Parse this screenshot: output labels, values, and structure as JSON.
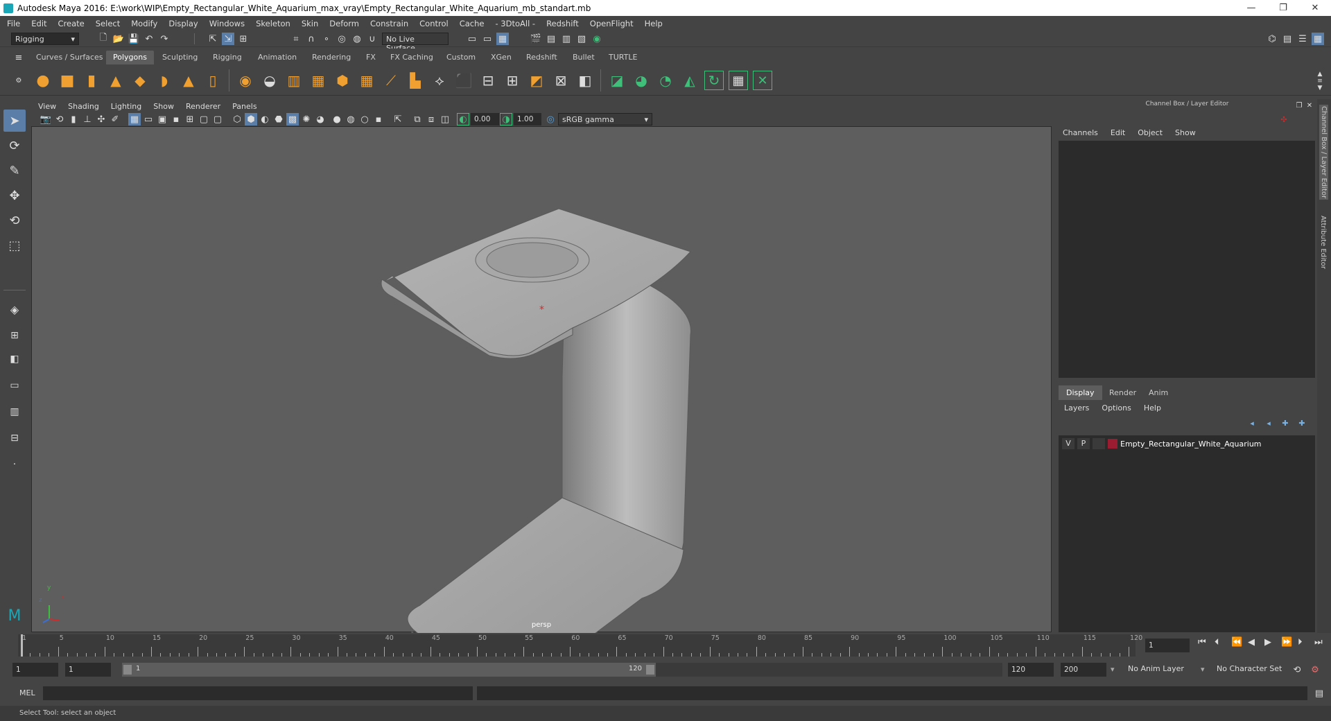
{
  "window": {
    "title": "Autodesk Maya 2016: E:\\work\\WIP\\Empty_Rectangular_White_Aquarium_max_vray\\Empty_Rectangular_White_Aquarium_mb_standart.mb",
    "minimize": "—",
    "restore": "❐",
    "close": "✕"
  },
  "menubar": [
    "File",
    "Edit",
    "Create",
    "Select",
    "Modify",
    "Display",
    "Windows",
    "Skeleton",
    "Skin",
    "Deform",
    "Constrain",
    "Control",
    "Cache",
    "- 3DtoAll -",
    "Redshift",
    "OpenFlight",
    "Help"
  ],
  "statusline": {
    "mode": "Rigging",
    "live_surface": "No Live Surface"
  },
  "shelf_tabs": [
    "Curves / Surfaces",
    "Polygons",
    "Sculpting",
    "Rigging",
    "Animation",
    "Rendering",
    "FX",
    "FX Caching",
    "Custom",
    "XGen",
    "Redshift",
    "Bullet",
    "TURTLE"
  ],
  "shelf_active": "Polygons",
  "panel_menu": [
    "View",
    "Shading",
    "Lighting",
    "Show",
    "Renderer",
    "Panels"
  ],
  "panel_tools": {
    "exposure": "0.00",
    "gamma": "1.00",
    "color_space": "sRGB gamma"
  },
  "viewport": {
    "camera_label": "persp",
    "axis_labels": {
      "y": "y",
      "x": "x",
      "z": "z"
    }
  },
  "right_panel": {
    "header": "Channel Box / Layer Editor",
    "channel_menu": [
      "Channels",
      "Edit",
      "Object",
      "Show"
    ],
    "layer_tabs": [
      "Display",
      "Render",
      "Anim"
    ],
    "layer_tab_active": "Display",
    "layer_menu": [
      "Layers",
      "Options",
      "Help"
    ],
    "layers": [
      {
        "v": "V",
        "p": "P",
        "name": "Empty_Rectangular_White_Aquarium",
        "color": "#9b1b30"
      }
    ]
  },
  "side_tabs": [
    "Channel Box / Layer Editor",
    "Attribute Editor"
  ],
  "timeline": {
    "ticks": [
      1,
      5,
      10,
      15,
      20,
      25,
      30,
      35,
      40,
      45,
      50,
      55,
      60,
      65,
      70,
      75,
      80,
      85,
      90,
      95,
      100,
      105,
      110,
      115,
      120
    ],
    "current_frame": "1"
  },
  "range": {
    "start": "1",
    "playback_start": "1",
    "slider_start": "1",
    "slider_end": "120",
    "playback_end": "120",
    "end": "200",
    "anim_layer": "No Anim Layer",
    "character_set": "No Character Set"
  },
  "cmdline": {
    "label": "MEL"
  },
  "helpline": "Select Tool: select an object",
  "colors": {
    "accent": "#5d5d5d",
    "bg": "#444444",
    "viewport": "#5e5e5e",
    "panel": "#2b2b2b"
  }
}
